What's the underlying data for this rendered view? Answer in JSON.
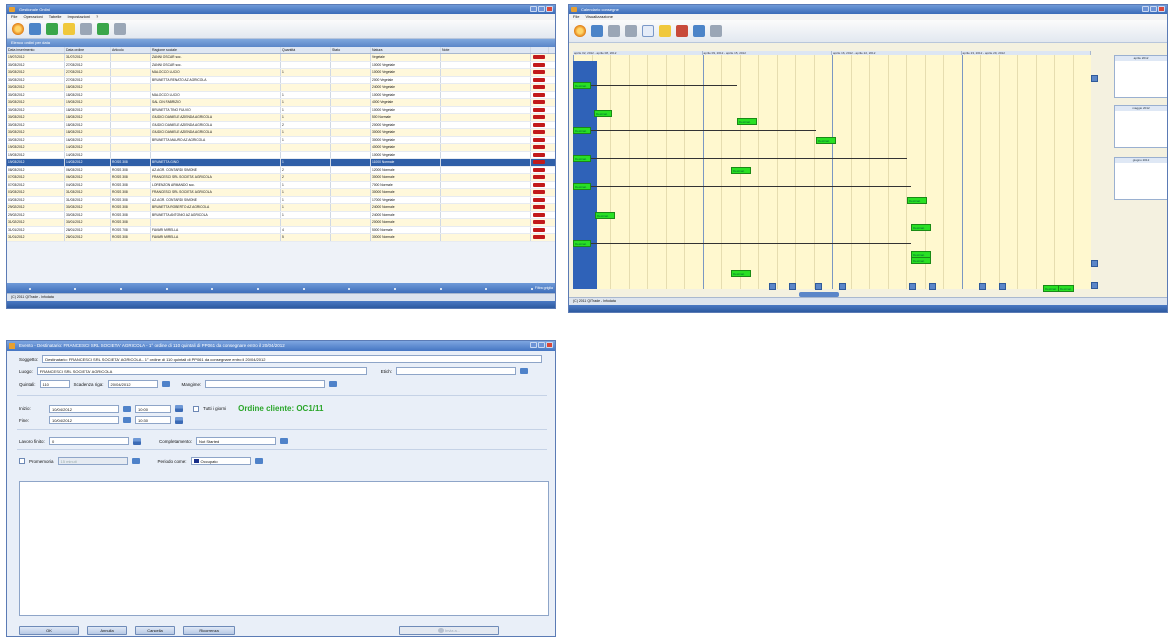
{
  "win1": {
    "title": "Gestionale Ordini",
    "menu": [
      "File",
      "Operazioni",
      "Tabelle",
      "Impostazioni",
      "?"
    ],
    "panel_title": "Elenco ordini per data",
    "columns": [
      "Data inserimento",
      "Data ordine",
      "Articolo",
      "Ragione sociale",
      "Quantità",
      "Stato",
      "Natura",
      "Note",
      ""
    ],
    "rows": [
      [
        "19/07/2012",
        "31/07/2012",
        "",
        "ZANNI OSCAR soc.",
        "",
        "",
        "Vegetale",
        ""
      ],
      [
        "30/03/2012",
        "27/03/2012",
        "",
        "ZANNI OSCAR soc.",
        "",
        "",
        "10000 Vegetale",
        ""
      ],
      [
        "30/03/2012",
        "27/03/2012",
        "",
        "MALOCCO LUCIO",
        "1",
        "",
        "10000 Vegetale",
        ""
      ],
      [
        "30/03/2012",
        "27/03/2012",
        "",
        "BRUNETTA RENATO AZ AGRICOLA",
        "",
        "",
        "2000 Vegetale",
        ""
      ],
      [
        "30/03/2012",
        "18/03/2012",
        "",
        "",
        "",
        "",
        "24000 Vegetale",
        ""
      ],
      [
        "30/03/2012",
        "18/03/2012",
        "",
        "MALOCCO LUCIO",
        "1",
        "",
        "10000 Vegetale",
        ""
      ],
      [
        "30/03/2012",
        "19/03/2012",
        "",
        "SAL CIN FABRIZIO",
        "1",
        "",
        "4000 Vegetale",
        ""
      ],
      [
        "30/03/2012",
        "18/03/2012",
        "",
        "BRUNETTA TINO FULVIO",
        "1",
        "",
        "10000 Vegetale",
        ""
      ],
      [
        "30/03/2012",
        "18/03/2012",
        "",
        "GIUDICI DANIELE AZIENDA AGRICOLA",
        "1",
        "",
        "500 Normale",
        ""
      ],
      [
        "30/03/2012",
        "18/03/2012",
        "",
        "GIUDICI DANIELE AZIENDA AGRICOLA",
        "2",
        "",
        "20000 Vegetale",
        ""
      ],
      [
        "30/03/2012",
        "18/03/2012",
        "",
        "GIUDICI DANIELE AZIENDA AGRICOLA",
        "1",
        "",
        "30000 Vegetale",
        ""
      ],
      [
        "30/03/2012",
        "16/03/2012",
        "",
        "BRUNETTA MAURO AZ AGRICOLA",
        "1",
        "",
        "30000 Vegetale",
        ""
      ],
      [
        "19/03/2012",
        "14/03/2012",
        "",
        "",
        "",
        "",
        "40000 Vegetale",
        ""
      ],
      [
        "19/03/2012",
        "14/03/2012",
        "",
        "",
        "",
        "",
        "10000 Vegetale",
        ""
      ],
      [
        "19/03/2012",
        "14/03/2012",
        "ROSS 308",
        "BRUNETTA GINO",
        "1",
        "",
        "11000 Normale",
        ""
      ],
      [
        "08/03/2012",
        "06/03/2012",
        "ROSS 308",
        "AZ.AGR. CONTARDI SIMONE",
        "2",
        "",
        "12000 Normale",
        ""
      ],
      [
        "07/03/2012",
        "06/03/2012",
        "ROSS 308",
        "FRANCESCI SRL SOCIETA' AGRICOLA",
        "2",
        "",
        "30000 Normale",
        ""
      ],
      [
        "07/03/2012",
        "04/03/2012",
        "ROSS 308",
        "LORENZON ARMANDO soc.",
        "1",
        "",
        "7000 Normale",
        ""
      ],
      [
        "03/03/2012",
        "31/03/2012",
        "ROSS 308",
        "FRANCESCI SRL SOCIETA' AGRICOLA",
        "1",
        "",
        "30000 Normale",
        ""
      ],
      [
        "03/03/2012",
        "31/03/2012",
        "ROSS 308",
        "AZ.AGR. CONTARDI SIMONE",
        "1",
        "",
        "17000 Vegetale",
        ""
      ],
      [
        "29/02/2012",
        "30/03/2012",
        "ROSS 308",
        "BRUNETTA ROBERTO AZ AGRICOLA",
        "1",
        "",
        "24000 Normale",
        ""
      ],
      [
        "29/02/2012",
        "30/03/2012",
        "ROSS 308",
        "BRUNETTA ANTONIO AZ AGRICOLA",
        "1",
        "",
        "24000 Normale",
        ""
      ],
      [
        "31/02/2012",
        "30/01/2012",
        "ROSS 308",
        "",
        "",
        "",
        "20000 Normale",
        ""
      ],
      [
        "31/01/2012",
        "28/01/2012",
        "ROSS 708",
        "FAVARI MIRELLA",
        "4",
        "",
        "5000 Normale",
        ""
      ],
      [
        "31/01/2012",
        "28/01/2012",
        "ROSS 308",
        "FAVARI MIRELLA",
        "5",
        "",
        "30000 Normale",
        ""
      ]
    ],
    "filter_label": "Filtra griglia",
    "status": "(C) 2011 QITrade - Infodata"
  },
  "win2": {
    "title": "Calendario consegne",
    "menu": [
      "File",
      "Visualizzazione"
    ],
    "weeks": [
      "aprile 02, 2012 - aprile 08, 2012",
      "aprile 09, 2012 - aprile 15, 2012",
      "aprile 16, 2012 - aprile 22, 2012",
      "aprile 23, 2012 - aprile 29, 2012"
    ],
    "bar_label": "Destinat.",
    "cal_months": [
      "aprile 2012",
      "maggio 2012",
      "giugno 2012"
    ],
    "status": "(C) 2011 QITrade - Infodata"
  },
  "win3": {
    "title": "Evento - Destinatario: FRANCESCI SRL SOCIETA' AGRICOLA - 1° ordine di 110 quintali di PP061 da consegnare entro il 20/04/2012",
    "soggetto_label": "Soggetto:",
    "soggetto_value": "Destinatario: FRANCESCI SRL SOCIETA' AGRICOLA - 1° ordine di 110 quintali di PP061 da consegnare entro il 20/04/2012",
    "luogo_label": "Luogo:",
    "luogo_value": "FRANCESCI SRL SOCIETA' AGRICOLA",
    "etich_label": "Etich:",
    "quintali_label": "Quintali:",
    "quintali_value": "110",
    "scadenza_label": "Scadenza riga:",
    "scadenza_value": "20/04/2012",
    "mangime_label": "Mangime:",
    "inizio_label": "Inizio:",
    "inizio_date": "10/04/2012",
    "inizio_time": "10:00",
    "fine_label": "Fine:",
    "fine_date": "10/04/2012",
    "fine_time": "10:30",
    "tutti_label": "Tutti i giorni",
    "ordine_label": "Ordine cliente: OC1/11",
    "lavoro_label": "Lavoro finito:",
    "lavoro_value": "0",
    "completamento_label": "Completamento:",
    "completamento_value": "Not Started",
    "promemoria_label": "Promemoria",
    "promemoria_value": "15 minuti",
    "periodo_label": "Periodo come:",
    "periodo_value": "Occupato",
    "buttons": [
      "OK",
      "Annulla",
      "Cancella",
      "Ricorrenza"
    ],
    "right_button": "Invia a...",
    "colors": {
      "accent": "#3a6bb8",
      "gantt_bar": "#29e024",
      "order_text": "#2aa62a",
      "row_selected": "#2f5fa8",
      "delete_button": "#c21a1a"
    }
  }
}
